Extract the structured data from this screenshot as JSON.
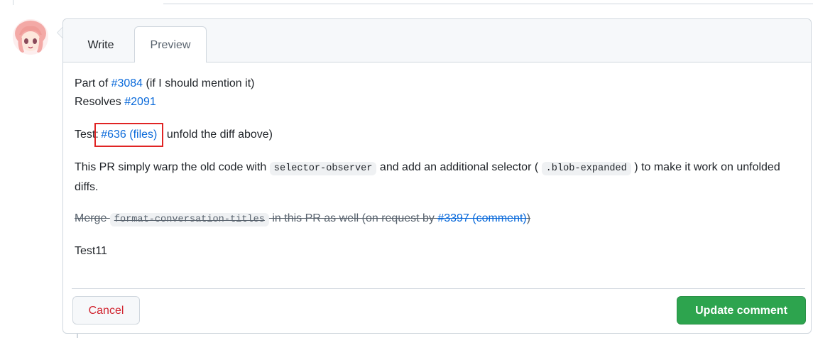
{
  "tabs": {
    "write": "Write",
    "preview": "Preview"
  },
  "preview": {
    "line1": {
      "prefix": "Part of ",
      "link": "#3084",
      "suffix": " (if I should mention it)"
    },
    "line2": {
      "prefix": "Resolves ",
      "link": "#2091"
    },
    "line3": {
      "prefix": "Test: ",
      "link": "#636 (files)",
      "suffix": " unfold the diff above)"
    },
    "line4": {
      "prefix": "This PR simply warp the old code with ",
      "code1": "selector-observer",
      "middle": " and add an additional selector ( ",
      "code2": ".blob-expanded",
      "suffix": " ) to make it work on unfolded diffs."
    },
    "line5": {
      "prefix": "Merge ",
      "code": "format-conversation-titles",
      "middle": " in this PR as well (on request by ",
      "link": "#3397 (comment)",
      "suffix": ")"
    },
    "line6": "Test11"
  },
  "buttons": {
    "cancel": "Cancel",
    "update": "Update comment"
  },
  "colors": {
    "link": "#0969da",
    "primary": "#2da44e",
    "danger": "#d1242f",
    "highlight_box": "#e02424"
  }
}
